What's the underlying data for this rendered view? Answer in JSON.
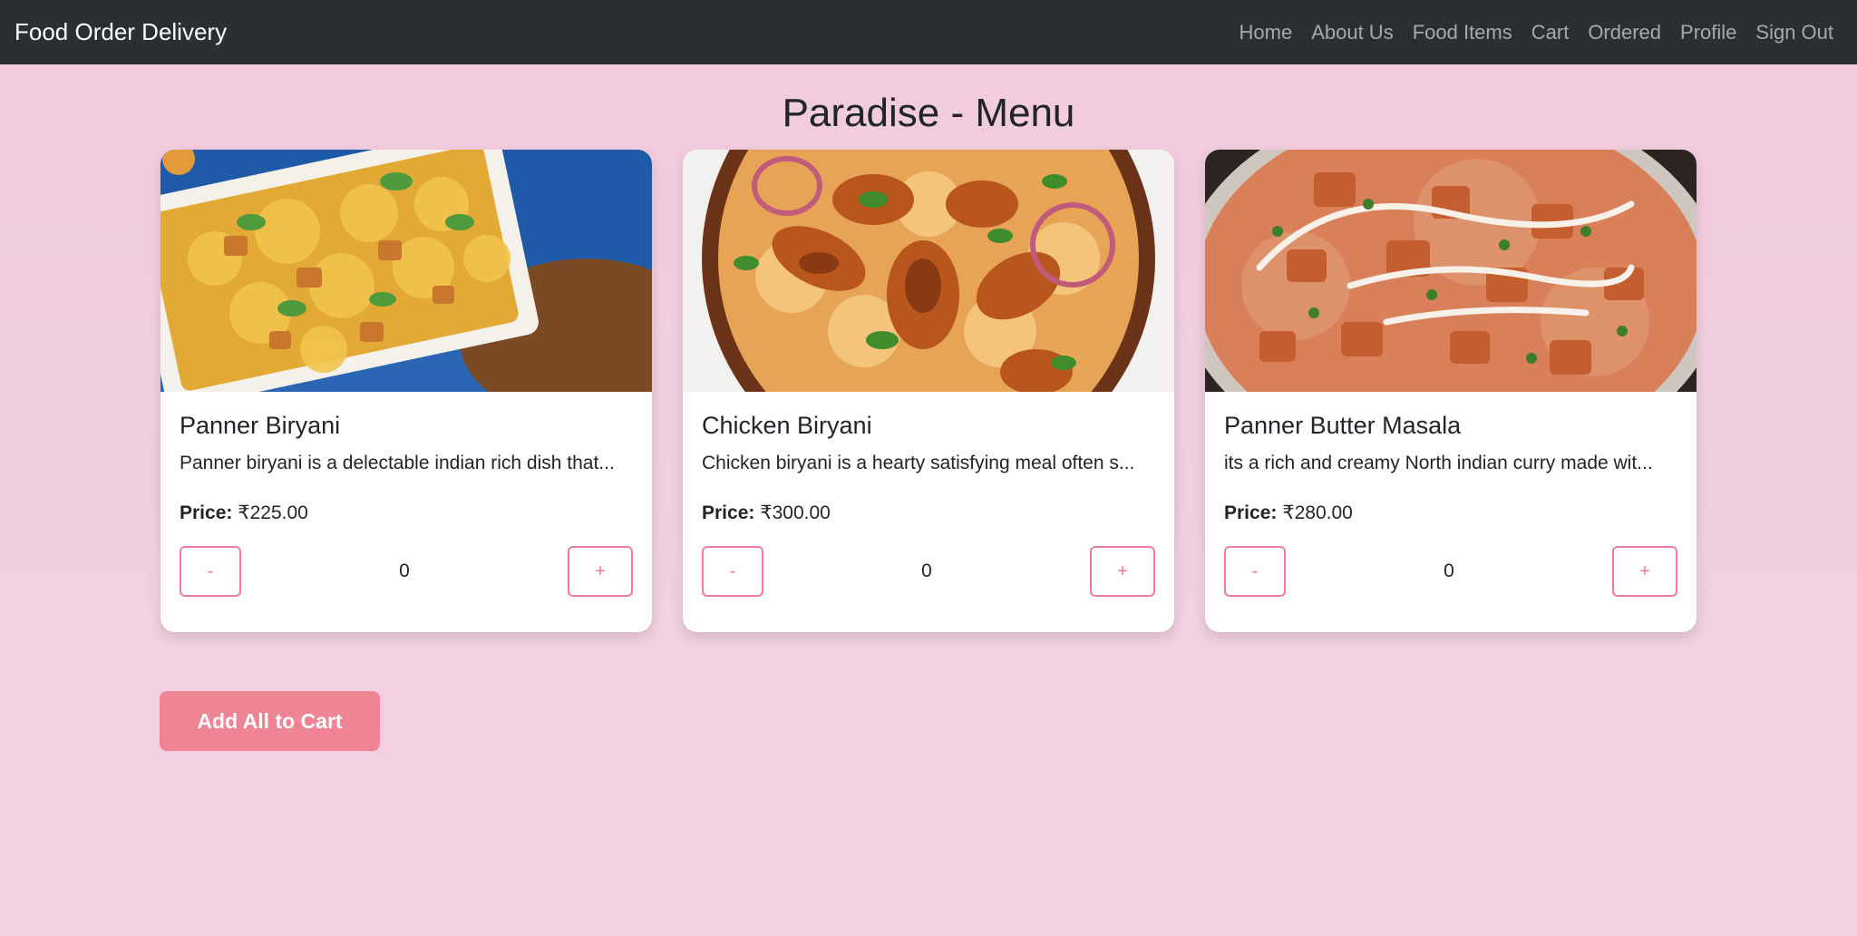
{
  "navbar": {
    "brand": "Food Order Delivery",
    "links": [
      "Home",
      "About Us",
      "Food Items",
      "Cart",
      "Ordered",
      "Profile",
      "Sign Out"
    ]
  },
  "page": {
    "title": "Paradise - Menu"
  },
  "items": [
    {
      "title": "Panner Biryani",
      "description": "Panner biryani is a delectable indian rich dish that...",
      "price_label": "Price:",
      "price": "₹225.00",
      "minus": "-",
      "quantity": "0",
      "plus": "+"
    },
    {
      "title": "Chicken Biryani",
      "description": "Chicken biryani is a hearty satisfying meal often s...",
      "price_label": "Price:",
      "price": "₹300.00",
      "minus": "-",
      "quantity": "0",
      "plus": "+"
    },
    {
      "title": "Panner Butter Masala",
      "description": "its a rich and creamy North indian curry made wit...",
      "price_label": "Price:",
      "price": "₹280.00",
      "minus": "-",
      "quantity": "0",
      "plus": "+"
    }
  ],
  "actions": {
    "add_all": "Add All to Cart"
  },
  "colors": {
    "navbar": "#2b2f34",
    "background": "#f0cfe0",
    "accent": "#ef7aa0",
    "add_button": "#ee8494"
  }
}
